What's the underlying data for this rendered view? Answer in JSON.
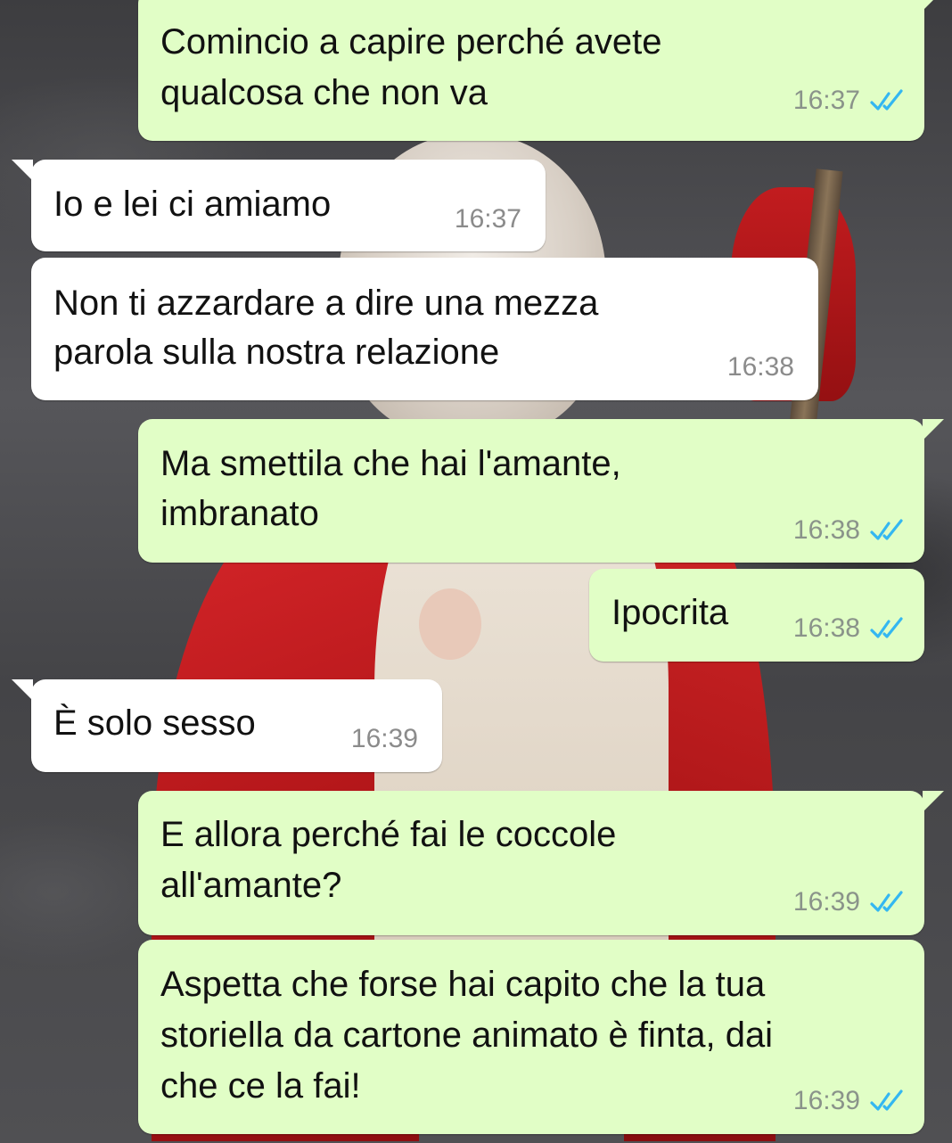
{
  "messages": [
    {
      "direction": "outgoing",
      "lines": [
        "Comincio a capire perché avete",
        "qualcosa che non va"
      ],
      "time": "16:37",
      "read": true
    },
    {
      "direction": "incoming",
      "lines": [
        "Io e lei ci amiamo"
      ],
      "time": "16:37"
    },
    {
      "direction": "incoming",
      "lines": [
        "Non ti azzardare a dire una mezza",
        "parola sulla nostra relazione"
      ],
      "time": "16:38"
    },
    {
      "direction": "outgoing",
      "lines": [
        "Ma smettila che hai l'amante,",
        "imbranato"
      ],
      "time": "16:38",
      "read": true
    },
    {
      "direction": "outgoing",
      "lines": [
        "Ipocrita"
      ],
      "time": "16:38",
      "read": true
    },
    {
      "direction": "incoming",
      "lines": [
        "È solo sesso"
      ],
      "time": "16:39"
    },
    {
      "direction": "outgoing",
      "lines": [
        "E allora perché fai le coccole",
        "all'amante?"
      ],
      "time": "16:39",
      "read": true
    },
    {
      "direction": "outgoing",
      "lines": [
        "Aspetta che forse hai capito che la tua",
        "storiella da cartone animato è finta, dai",
        "che ce la fai!"
      ],
      "time": "16:39",
      "read": true
    }
  ],
  "colors": {
    "outgoing_bubble": "#e1fec6",
    "incoming_bubble": "#ffffff",
    "read_ticks": "#34b7f1",
    "timestamp": "#8a938a"
  },
  "icons": {
    "read_receipt": "double-check-icon"
  }
}
